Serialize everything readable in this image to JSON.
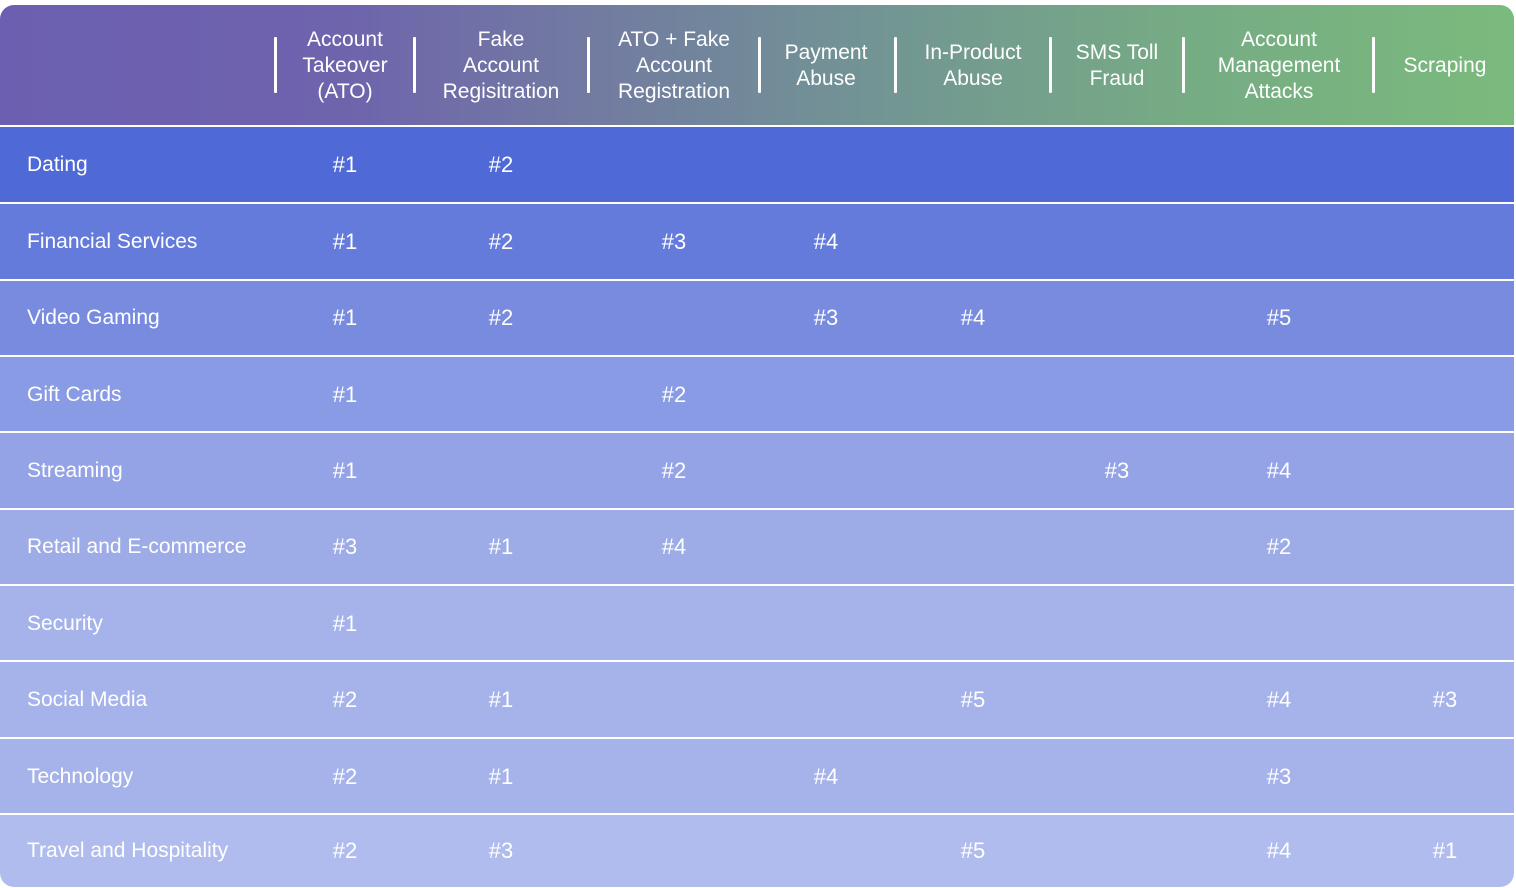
{
  "table": {
    "columns": [
      {
        "key": "ato",
        "label_lines": [
          "Account",
          "Takeover",
          "(ATO)"
        ]
      },
      {
        "key": "fake",
        "label_lines": [
          "Fake",
          "Account",
          "Regisitration"
        ]
      },
      {
        "key": "ato_fake",
        "label_lines": [
          "ATO + Fake",
          "Account",
          "Registration"
        ]
      },
      {
        "key": "payment",
        "label_lines": [
          "Payment",
          "Abuse"
        ]
      },
      {
        "key": "inproduct",
        "label_lines": [
          "In-Product",
          "Abuse"
        ]
      },
      {
        "key": "sms",
        "label_lines": [
          "SMS Toll",
          "Fraud"
        ]
      },
      {
        "key": "acctmgmt",
        "label_lines": [
          "Account",
          "Management",
          "Attacks"
        ]
      },
      {
        "key": "scraping",
        "label_lines": [
          "Scraping"
        ]
      }
    ],
    "rows": [
      {
        "industry": "Dating",
        "bg": "#4f69d6",
        "ranks": [
          "#1",
          "#2",
          "",
          "",
          "",
          "",
          "",
          ""
        ]
      },
      {
        "industry": "Financial Services",
        "bg": "#647bdb",
        "ranks": [
          "#1",
          "#2",
          "#3",
          "#4",
          "",
          "",
          "",
          ""
        ]
      },
      {
        "industry": "Video Gaming",
        "bg": "#788bdf",
        "ranks": [
          "#1",
          "#2",
          "",
          "#3",
          "#4",
          "",
          "#5",
          ""
        ]
      },
      {
        "industry": "Gift Cards",
        "bg": "#889be4",
        "ranks": [
          "#1",
          "",
          "#2",
          "",
          "",
          "",
          "",
          ""
        ]
      },
      {
        "industry": "Streaming",
        "bg": "#94a3e5",
        "ranks": [
          "#1",
          "",
          "#2",
          "",
          "",
          "#3",
          "#4",
          ""
        ]
      },
      {
        "industry": "Retail and E-commerce",
        "bg": "#9dabe7",
        "ranks": [
          "#3",
          "#1",
          "#4",
          "",
          "",
          "",
          "#2",
          ""
        ]
      },
      {
        "industry": "Security",
        "bg": "#a6b3ea",
        "ranks": [
          "#1",
          "",
          "",
          "",
          "",
          "",
          "",
          ""
        ]
      },
      {
        "industry": "Social Media",
        "bg": "#a6b3ea",
        "ranks": [
          "#2",
          "#1",
          "",
          "",
          "#5",
          "",
          "#4",
          "#3"
        ]
      },
      {
        "industry": "Technology",
        "bg": "#a6b3ea",
        "ranks": [
          "#2",
          "#1",
          "",
          "#4",
          "",
          "",
          "#3",
          ""
        ]
      },
      {
        "industry": "Travel and Hospitality",
        "bg": "#b0bced",
        "ranks": [
          "#2",
          "#3",
          "",
          "",
          "#5",
          "",
          "#4",
          "#1"
        ]
      }
    ]
  }
}
